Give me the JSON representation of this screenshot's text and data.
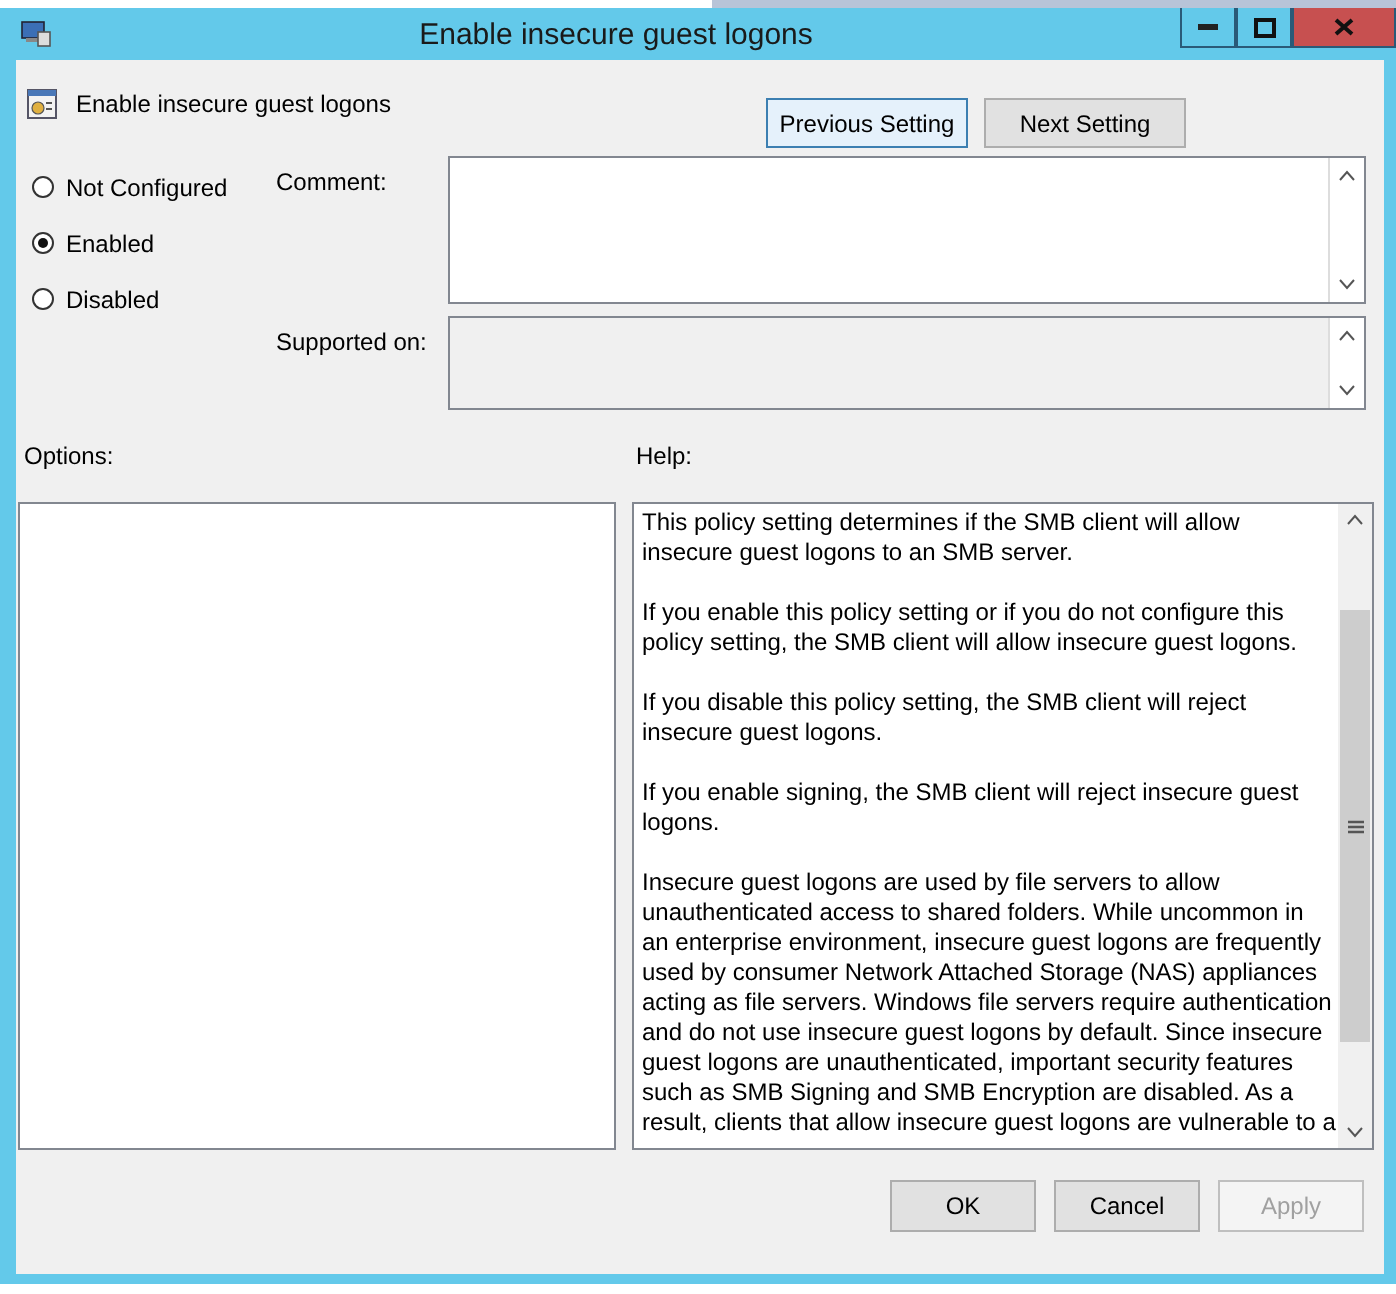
{
  "window": {
    "title": "Enable insecure guest logons"
  },
  "policy": {
    "name": "Enable insecure guest logons"
  },
  "nav_buttons": [
    {
      "label": "Previous Setting",
      "focused": true
    },
    {
      "label": "Next Setting",
      "focused": false
    }
  ],
  "state_options": [
    {
      "label": "Not Configured",
      "selected": false
    },
    {
      "label": "Enabled",
      "selected": true
    },
    {
      "label": "Disabled",
      "selected": false
    }
  ],
  "comment": {
    "label": "Comment:"
  },
  "supported_on": {
    "label": "Supported on:"
  },
  "options": {
    "label": "Options:"
  },
  "help": {
    "label": "Help:",
    "paragraphs": [
      [
        "This policy setting determines if the SMB client will allow",
        "insecure guest logons to an SMB server."
      ],
      [
        "If you enable this policy setting or if you do not configure this",
        "policy setting, the SMB client will allow insecure guest logons."
      ],
      [
        "If you disable this policy setting, the SMB client will reject",
        "insecure guest logons."
      ],
      [
        "If you enable signing, the SMB client will reject insecure guest",
        "logons."
      ],
      [
        "Insecure guest logons are used by file servers to allow",
        "unauthenticated access to shared folders. While uncommon in",
        "an enterprise environment, insecure guest logons are frequently",
        "used by consumer Network Attached Storage (NAS) appliances",
        "acting as file servers. Windows file servers require authentication",
        "and do not use insecure guest logons by default. Since insecure",
        "guest logons are unauthenticated, important security features",
        "such as SMB Signing and SMB Encryption are disabled. As a",
        "result, clients that allow insecure guest logons are vulnerable to a"
      ]
    ]
  },
  "buttons": [
    {
      "label": "OK",
      "disabled": false
    },
    {
      "label": "Cancel",
      "disabled": false
    },
    {
      "label": "Apply",
      "disabled": true
    }
  ]
}
